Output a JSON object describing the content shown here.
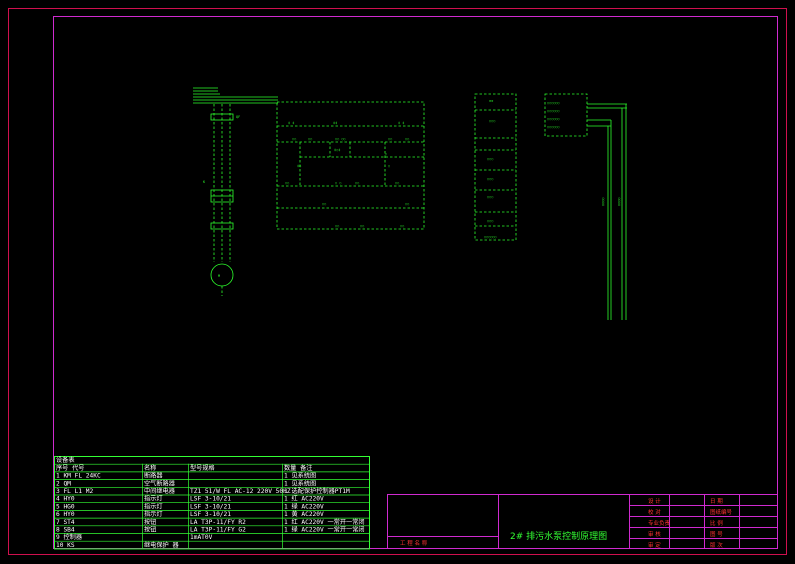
{
  "drawing": {
    "title": "2# 排污水泵控制原理图",
    "parts_table": {
      "heading": "设备表",
      "headers": [
        "序号 代号",
        "名称",
        "型号规格",
        "数量 备注"
      ],
      "rows": [
        [
          "1 KM FL 24KC",
          "断路器",
          "",
          "1 见系统图"
        ],
        [
          "2 QM",
          "空气断路器",
          "",
          "1 见系统图"
        ],
        [
          "3 FL L1 M2",
          "中间继电器",
          "TZ1 51/W FL AC-12 220V 50HZ",
          "1 选配保护控制器PT1M"
        ],
        [
          "4 HY0",
          "指示灯",
          "LSF 3-10/21",
          "1 红 AC220V"
        ],
        [
          "5 HG0",
          "指示灯",
          "LSF 3-10/21",
          "1 绿 AC220V"
        ],
        [
          "6 HY0",
          "指示灯",
          "LSF 3-10/21",
          "1 黄 AC220V"
        ],
        [
          "7 ST4",
          "按钮",
          "LA T3P-11/FY R2",
          "1 红 AC220V 一常开一常闭"
        ],
        [
          "8 SB4",
          "按钮",
          "LA T3P-11/FY G2",
          "1 绿 AC220V 一常开一常闭"
        ],
        [
          "9 控制器",
          "",
          "1mAT0V",
          ""
        ],
        [
          "10 KS",
          "继电保护 器",
          "",
          ""
        ]
      ]
    },
    "title_block": {
      "left_cell": "工 程 名 称",
      "right_labels": [
        "设 计",
        "校 对",
        "专业负责",
        "审 核",
        "审 定"
      ],
      "right_values": [
        "日 期",
        "图纸编号",
        "比 例",
        "图 号",
        "版 次"
      ]
    }
  }
}
